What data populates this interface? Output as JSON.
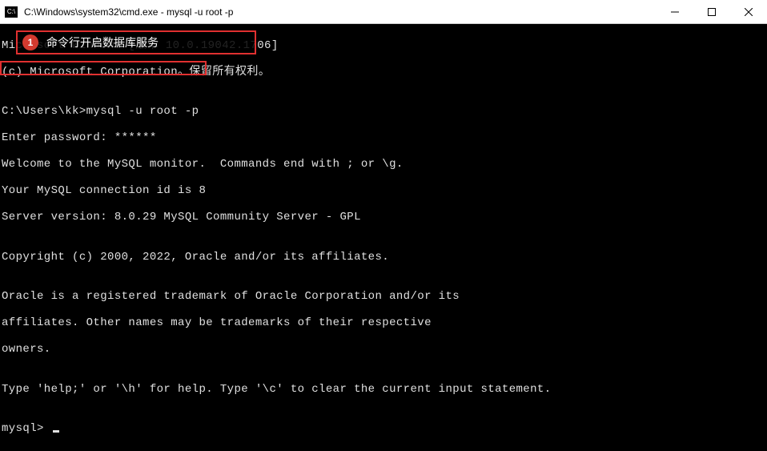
{
  "titlebar": {
    "icon_label": "C:\\",
    "title": "C:\\Windows\\system32\\cmd.exe - mysql  -u root -p"
  },
  "annotations": {
    "box1": {
      "badge": "1",
      "text": "命令行开启数据库服务"
    }
  },
  "terminal": {
    "line1": "Microsoft Windows [版本 10.0.19042.1706]",
    "line2": "(c) Microsoft Corporation。保留所有权利。",
    "blank1": "",
    "line3": "C:\\Users\\kk>mysql -u root -p",
    "line4": "Enter password: ******",
    "line5": "Welcome to the MySQL monitor.  Commands end with ; or \\g.",
    "line6": "Your MySQL connection id is 8",
    "line7": "Server version: 8.0.29 MySQL Community Server - GPL",
    "blank2": "",
    "line8": "Copyright (c) 2000, 2022, Oracle and/or its affiliates.",
    "blank3": "",
    "line9": "Oracle is a registered trademark of Oracle Corporation and/or its",
    "line10": "affiliates. Other names may be trademarks of their respective",
    "line11": "owners.",
    "blank4": "",
    "line12": "Type 'help;' or '\\h' for help. Type '\\c' to clear the current input statement.",
    "blank5": "",
    "prompt": "mysql> "
  }
}
